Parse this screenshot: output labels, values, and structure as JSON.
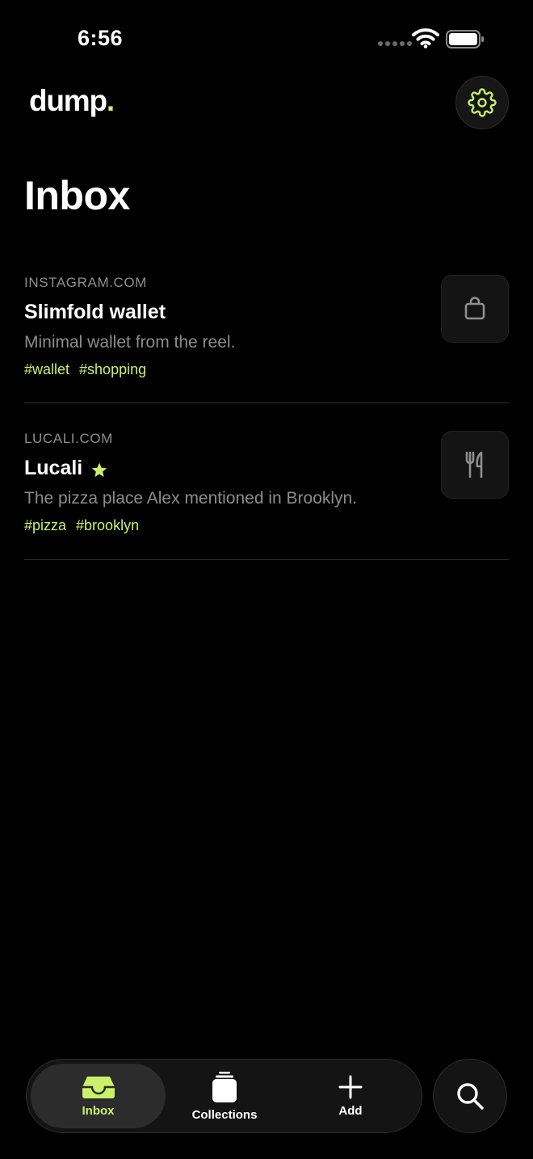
{
  "status_bar": {
    "time": "6:56"
  },
  "header": {
    "logo_text": "dump",
    "logo_dot": ".",
    "settings_icon": "gear-icon",
    "title": "Inbox"
  },
  "items": [
    {
      "source": "INSTAGRAM.COM",
      "title": "Slimfold wallet",
      "starred": false,
      "description": "Minimal wallet from the reel.",
      "tags": [
        "#wallet",
        "#shopping"
      ],
      "icon": "shopping-bag-icon"
    },
    {
      "source": "LUCALI.COM",
      "title": "Lucali",
      "starred": true,
      "description": "The pizza place Alex mentioned in Brooklyn.",
      "tags": [
        "#pizza",
        "#brooklyn"
      ],
      "icon": "fork-knife-icon"
    }
  ],
  "tab_bar": {
    "tabs": [
      {
        "label": "Inbox",
        "icon": "inbox-tray-icon",
        "selected": true
      },
      {
        "label": "Collections",
        "icon": "collections-stack-icon",
        "selected": false
      },
      {
        "label": "Add",
        "icon": "plus-icon",
        "selected": false
      }
    ],
    "search_icon": "search-icon"
  },
  "colors": {
    "accent": "#c9f26a",
    "background": "#000000",
    "surface": "#141414",
    "muted_text": "#8c8c8c",
    "divider": "#2e2e2e"
  }
}
